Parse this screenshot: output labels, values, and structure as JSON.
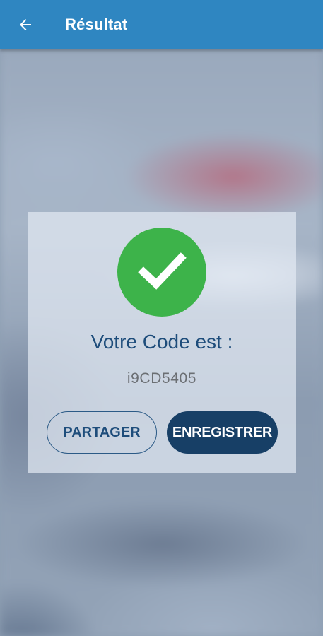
{
  "appbar": {
    "title": "Résultat",
    "back_icon": "arrow-left-icon",
    "background_color": "#2f86c1"
  },
  "dialog": {
    "status_icon": "check-icon",
    "status_color": "#3db34a",
    "label": "Votre Code est :",
    "code": "i9CD5405",
    "share_label": "PARTAGER",
    "save_label": "ENREGISTRER",
    "save_button_color": "#173f66",
    "text_color": "#1e4d7b"
  }
}
